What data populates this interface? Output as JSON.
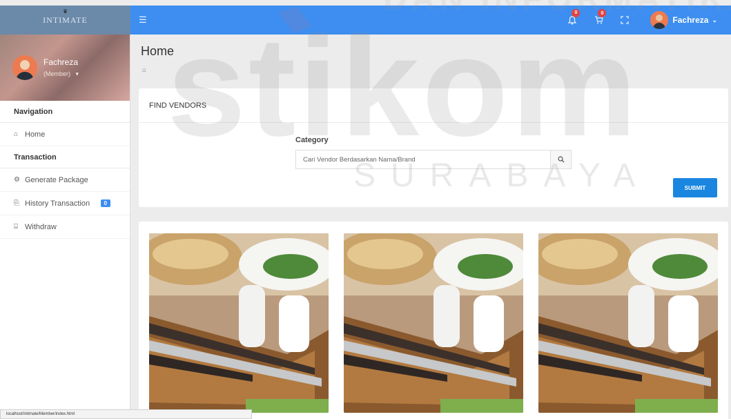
{
  "app": {
    "brand": "INTIMATE"
  },
  "topbar": {
    "menu_icon": "hamburger-icon",
    "notifications": {
      "icon": "bell-icon",
      "count": "0"
    },
    "cart": {
      "icon": "cart-icon",
      "count": "0"
    },
    "fullscreen_icon": "expand-icon",
    "user_name": "Fachreza"
  },
  "sidebar": {
    "user_name": "Fachreza",
    "user_role": "(Member)",
    "sections": [
      {
        "title": "Navigation"
      },
      {
        "title": "Transaction"
      }
    ],
    "items": [
      {
        "label": "Home",
        "icon": "home-icon"
      },
      {
        "label": "Generate Package",
        "icon": "gears-icon"
      },
      {
        "label": "History Transaction",
        "icon": "history-icon",
        "badge": "0"
      },
      {
        "label": "Withdraw",
        "icon": "bank-icon"
      }
    ]
  },
  "page": {
    "title": "Home",
    "breadcrumb_icon": "home-icon"
  },
  "find_vendors": {
    "title": "FIND VENDORS",
    "category_label": "Category",
    "search_placeholder": "Cari Vendor Berdasarkan Nama/Brand",
    "submit_label": "SUBMIT"
  },
  "vendors": [
    {
      "image": "vendor-photo"
    },
    {
      "image": "vendor-photo"
    },
    {
      "image": "vendor-photo"
    }
  ],
  "watermark": {
    "main": "stikom",
    "sub": "SURABAYA",
    "top": "DAN INFORMATIKA"
  },
  "status_url": "localhost/intimate/Member/index.html",
  "colors": {
    "topbar": "#3d8ef0",
    "accent": "#1a86e0",
    "badge": "#e24343"
  }
}
